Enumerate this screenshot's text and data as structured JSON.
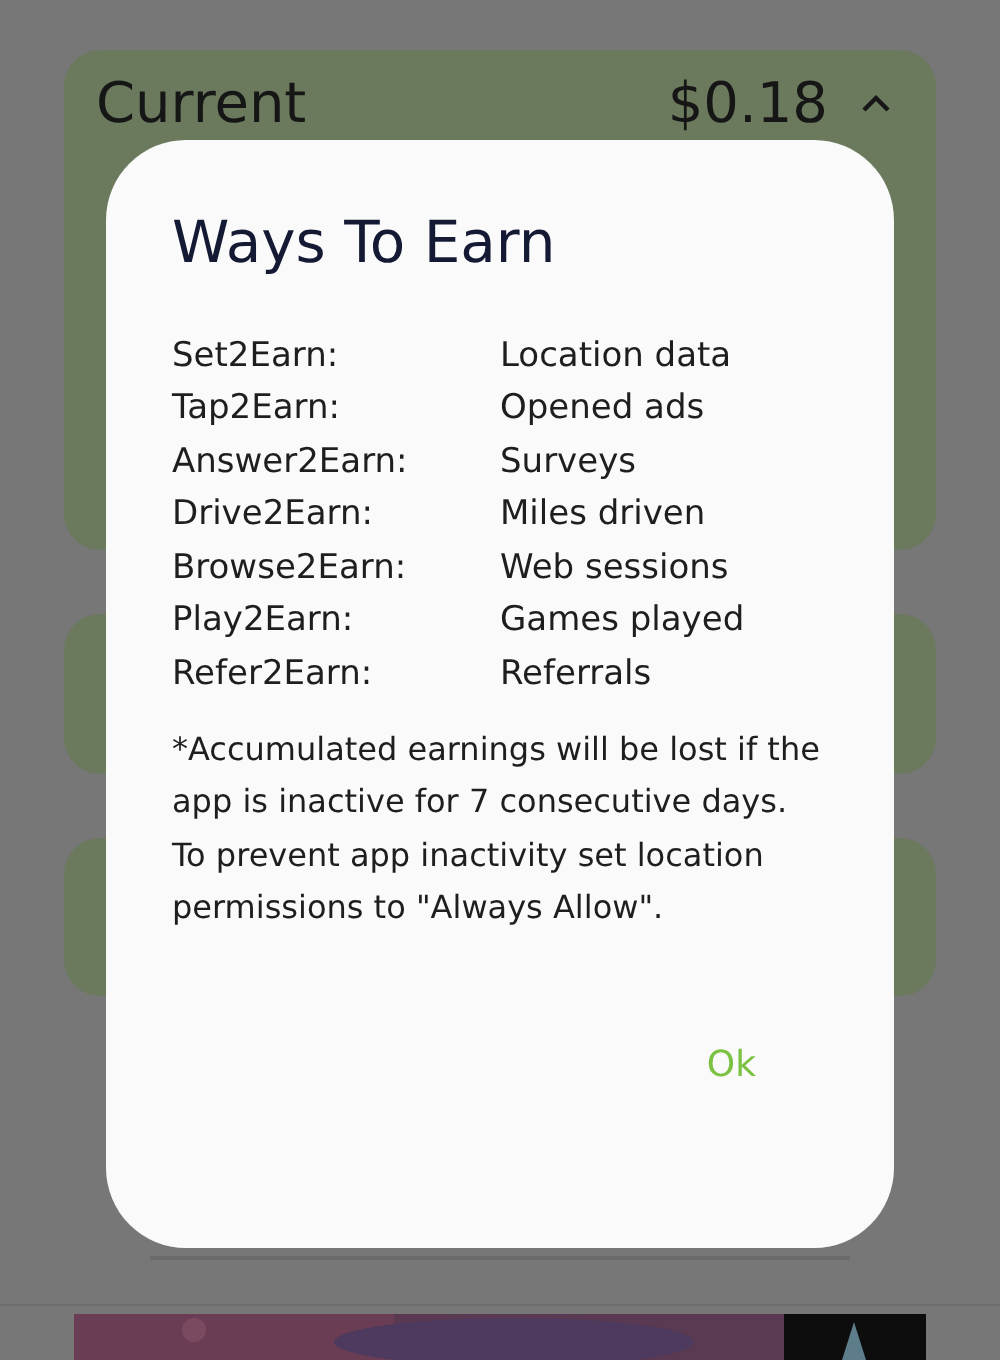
{
  "summary_card": {
    "label": "Current",
    "amount": "$0.18",
    "expanded": true
  },
  "dialog": {
    "title": "Ways To Earn",
    "rows": [
      {
        "name": "Set2Earn:",
        "source": "Location data"
      },
      {
        "name": "Tap2Earn:",
        "source": "Opened ads"
      },
      {
        "name": "Answer2Earn:",
        "source": "Surveys"
      },
      {
        "name": "Drive2Earn:",
        "source": "Miles driven"
      },
      {
        "name": "Browse2Earn:",
        "source": "Web sessions"
      },
      {
        "name": "Play2Earn:",
        "source": "Games played"
      },
      {
        "name": "Refer2Earn:",
        "source": "Referrals"
      }
    ],
    "note": "*Accumulated earnings will be lost if the app is inactive for 7 consecutive days. To prevent app inactivity set location permissions to \"Always Allow\".",
    "button": "Ok"
  }
}
